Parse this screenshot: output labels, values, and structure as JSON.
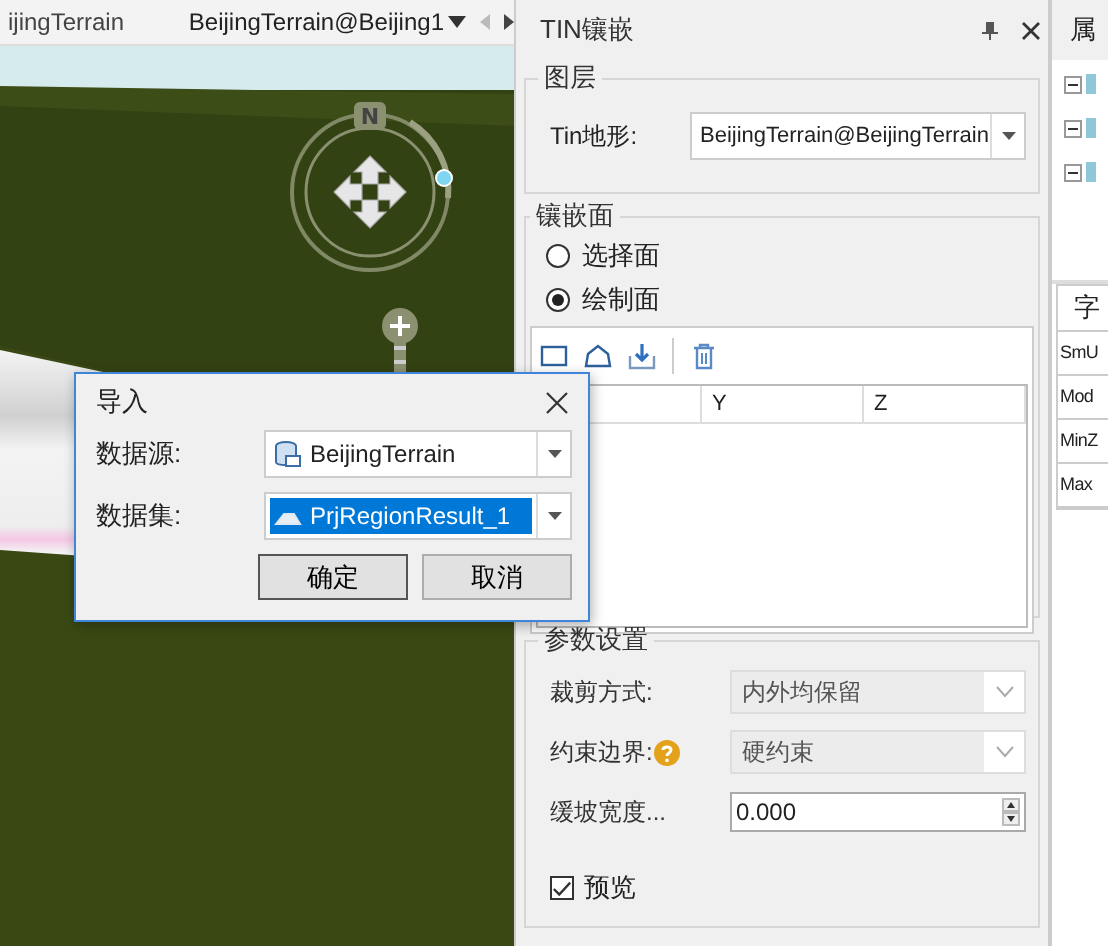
{
  "document_tabs": [
    {
      "label": "ijingTerrain",
      "selected": false
    },
    {
      "label": "BeijingTerrain@Beijing1",
      "selected": true
    }
  ],
  "scene": {
    "kind": "picture",
    "compass_label": "N"
  },
  "tin_panel": {
    "title": "TIN镶嵌",
    "layer_group": {
      "title": "图层",
      "label": "Tin地形:",
      "value": "BeijingTerrain@BeijingTerrain"
    },
    "surface_group": {
      "title": "镶嵌面",
      "options": [
        {
          "label": "选择面",
          "selected": false
        },
        {
          "label": "绘制面",
          "selected": true
        }
      ],
      "columns": [
        "Y",
        "Z"
      ]
    },
    "params_group": {
      "title": "参数设置",
      "fields": [
        {
          "kind": "dropdown",
          "label": "裁剪方式:",
          "value": "内外均保留",
          "disabled": true,
          "help": false
        },
        {
          "kind": "dropdown",
          "label": "约束边界:",
          "value": "硬约束",
          "disabled": true,
          "help": true
        },
        {
          "kind": "spinner",
          "label": "缓坡宽度...",
          "value": "0.000",
          "help": false
        }
      ],
      "preview": {
        "label": "预览",
        "checked": true
      }
    }
  },
  "properties_panel": {
    "title": "属",
    "tree": [
      {
        "expanded": true
      },
      {
        "expanded": true
      },
      {
        "expanded": true
      }
    ],
    "table": {
      "header": "字",
      "rows": [
        "SmU",
        "Mod",
        "MinZ",
        "Max"
      ]
    }
  },
  "import_dialog": {
    "title": "导入",
    "fields": [
      {
        "label": "数据源:",
        "value": "BeijingTerrain",
        "selected": false
      },
      {
        "label": "数据集:",
        "value": "PrjRegionResult_1",
        "selected": true
      }
    ],
    "buttons": [
      {
        "label": "确定",
        "default": true
      },
      {
        "label": "取消",
        "default": false
      }
    ]
  }
}
